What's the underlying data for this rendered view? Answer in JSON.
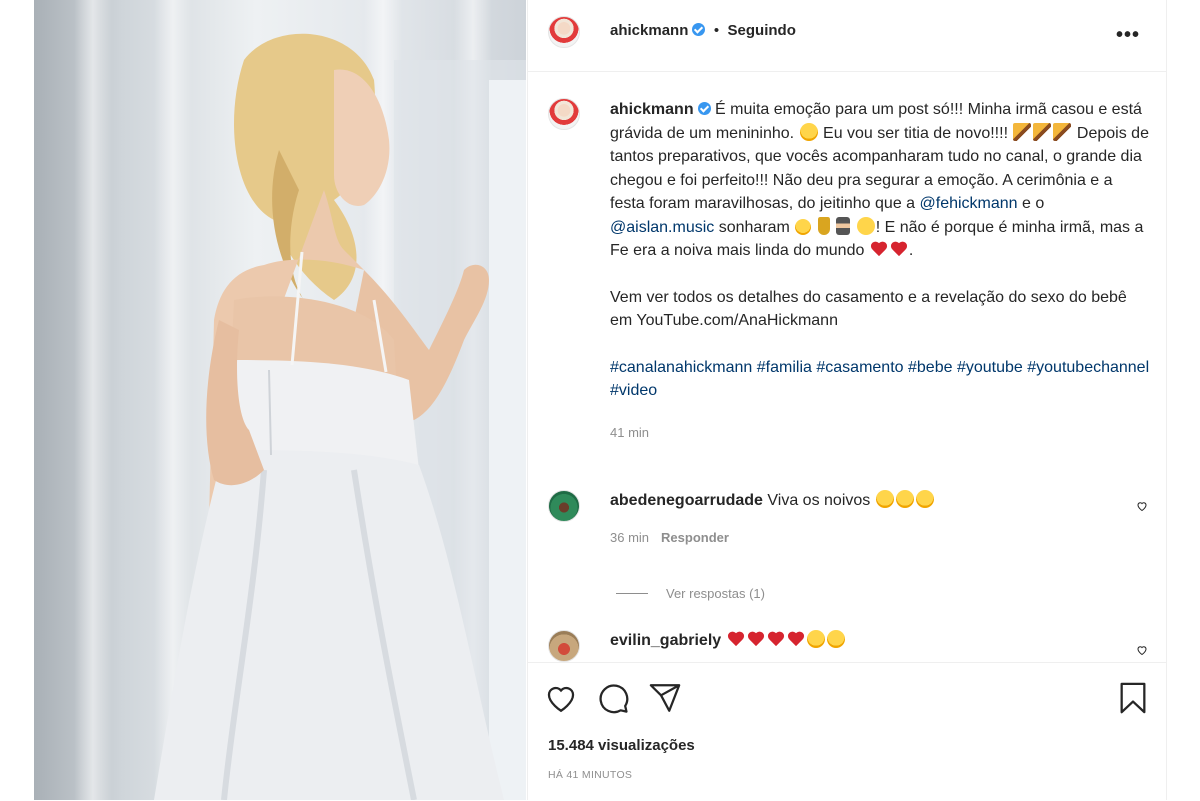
{
  "post": {
    "username": "ahickmann",
    "follow_status": "Seguindo",
    "separator": "•",
    "more_label": "•••",
    "caption": {
      "username": "ahickmann",
      "p1": "É muita emoção para um post só!!! Minha irmã casou e está grávida de um menininho.",
      "p2": "Eu vou ser titia de novo!!!!",
      "p3": "Depois de tantos preparativos, que vocês acompanharam tudo no canal, o grande dia chegou e foi perfeito!!! Não deu pra segurar a emoção. A cerimônia e a festa foram maravilhosas, do jeitinho que a",
      "mention1": "@fehickmann",
      "p4": " e o ",
      "mention2": "@aislan.music",
      "p5": " sonharam",
      "p6": "! E não é porque é minha irmã, mas a Fe era a noiva mais linda do mundo",
      "p7": ".",
      "p8": "Vem ver todos os detalhes do casamento e a revelação do sexo do bebê em YouTube.com/AnaHickmann",
      "hashtags": [
        "#canalanahickmann",
        "#familia",
        "#casamento",
        "#bebe",
        "#youtube",
        "#youtubechannel",
        "#video"
      ],
      "time": "41 min"
    },
    "comments": [
      {
        "username": "abedenegoarrudade",
        "text": "Viva os noivos",
        "time": "36 min",
        "reply_label": "Responder"
      },
      {
        "username": "evilin_gabriely",
        "text": ""
      }
    ],
    "view_replies": "Ver respostas (1)",
    "views": "15.484 visualizações",
    "posted_ago": "HÁ 41 MINUTOS"
  },
  "icons": [
    "like-icon",
    "comment-icon",
    "share-icon",
    "save-icon",
    "heart-small-icon",
    "verified-icon"
  ],
  "colors": {
    "link": "#00376b",
    "verified": "#3897f0",
    "text": "#262626",
    "muted": "#8e8e8e",
    "heart": "#d6242f"
  }
}
